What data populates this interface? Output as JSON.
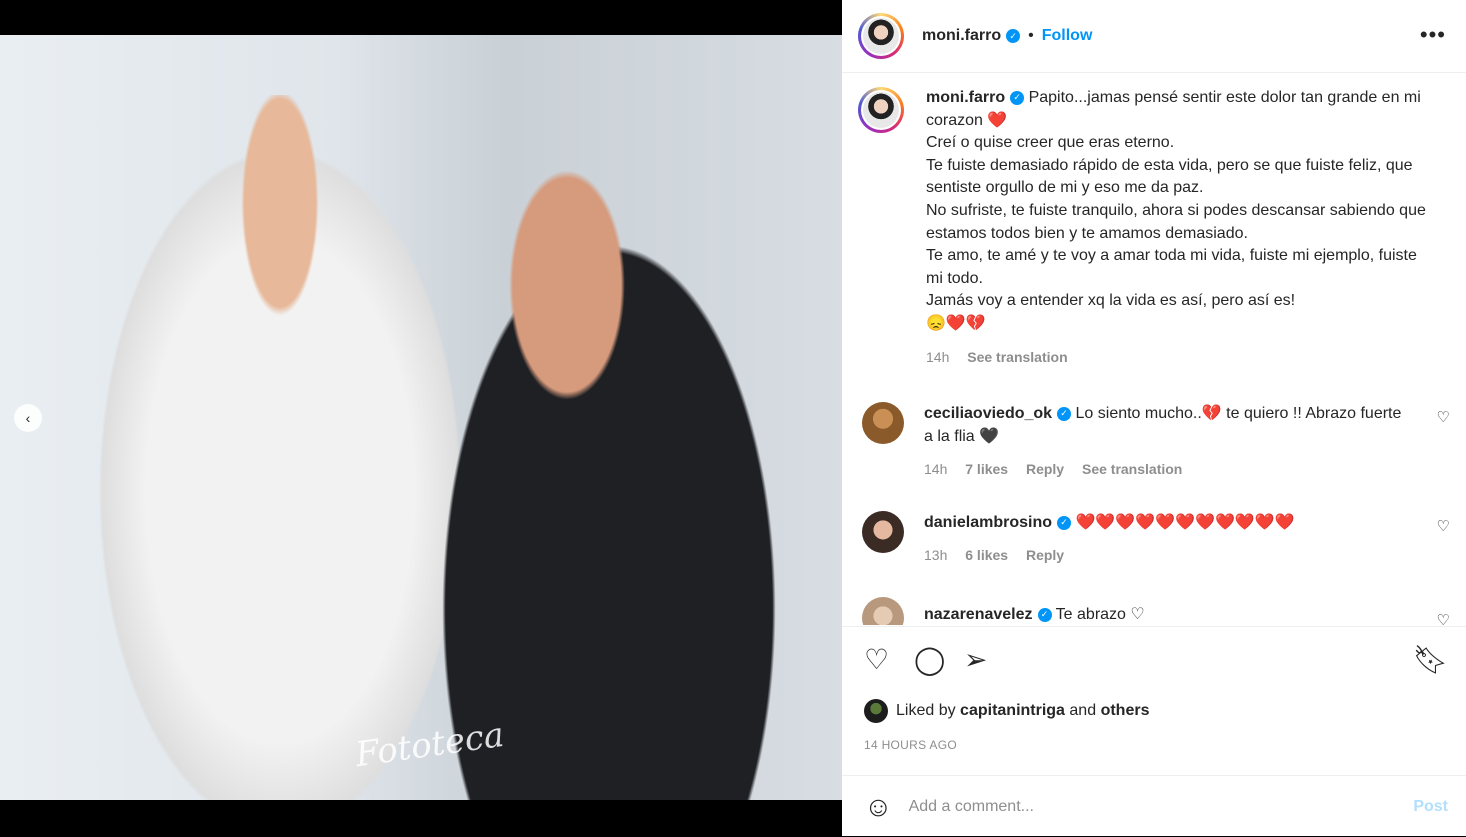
{
  "post": {
    "watermark": "Fototeca",
    "header": {
      "username": "moni.farro",
      "separator": "•",
      "follow": "Follow",
      "more": "•••"
    },
    "caption": {
      "username": "moni.farro",
      "lines": [
        "Papito...jamas pensé sentir este dolor tan grande en mi corazon ❤️",
        "Creí o quise creer que eras eterno.",
        "Te fuiste demasiado rápido de esta vida, pero se que fuiste feliz, que sentiste orgullo de mi y eso me da paz.",
        "No sufriste, te fuiste tranquilo, ahora si podes descansar sabiendo que estamos todos bien y te amamos demasiado.",
        "Te amo, te amé y te voy a amar toda mi vida, fuiste mi ejemplo, fuiste mi todo.",
        "Jamás voy a entender xq la vida es así, pero así es!",
        "😞❤️💔"
      ],
      "time": "14h",
      "see_translation": "See translation"
    },
    "comments": [
      {
        "username": "ceciliaoviedo_ok",
        "text": "Lo siento mucho..💔 te quiero !! Abrazo fuerte a la flia 🖤",
        "time": "14h",
        "likes": "7 likes",
        "reply": "Reply",
        "see_translation": "See translation"
      },
      {
        "username": "danielambrosino",
        "text": "❤️❤️❤️❤️❤️❤️❤️❤️❤️❤️❤️",
        "time": "13h",
        "likes": "6 likes",
        "reply": "Reply"
      },
      {
        "username": "nazarenavelez",
        "text": "Te abrazo ♡"
      }
    ],
    "liked": {
      "prefix": "Liked by",
      "user": "capitanintriga",
      "and": "and",
      "others": "others"
    },
    "timestamp": "14 HOURS AGO",
    "add_comment": {
      "placeholder": "Add a comment...",
      "post": "Post"
    }
  },
  "colors": {
    "accent": "#0095f6",
    "muted": "#8e8e8e",
    "post_disabled": "#b2dffc"
  }
}
